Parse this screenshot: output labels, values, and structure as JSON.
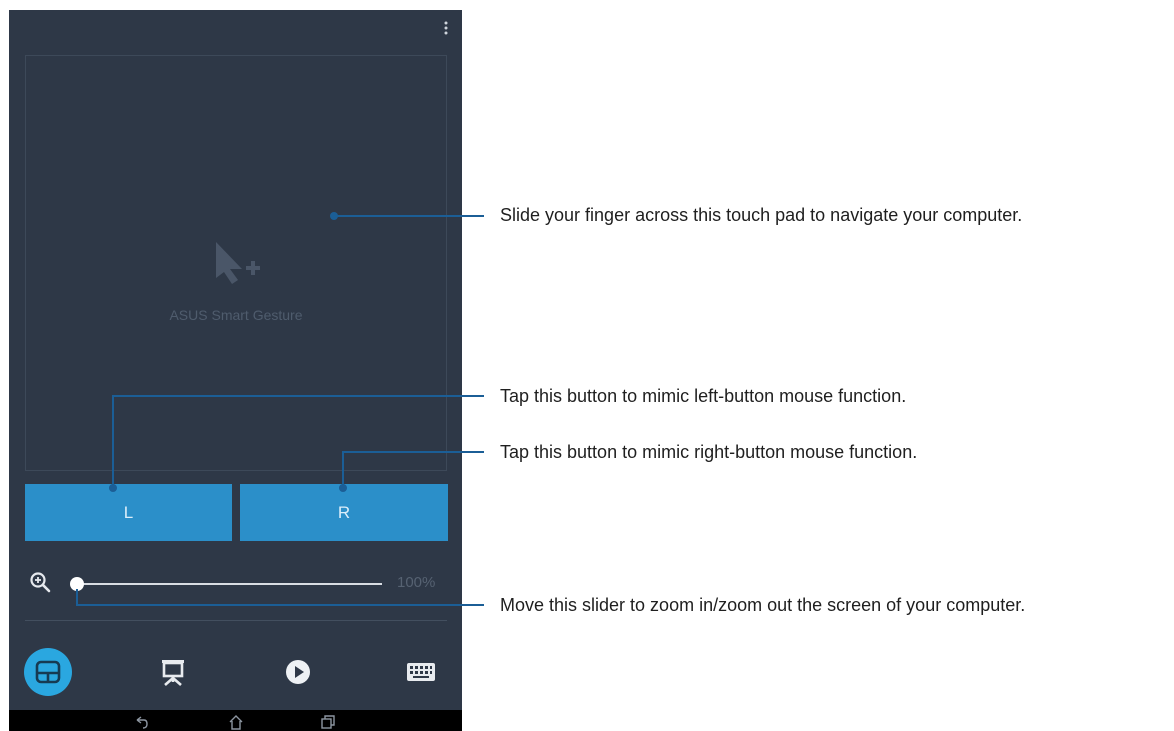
{
  "app": {
    "name": "ASUS Smart Gesture",
    "touchpad_label": "ASUS Smart Gesture",
    "left_button_label": "L",
    "right_button_label": "R",
    "zoom": {
      "value_text": "100%",
      "level": 0.0
    },
    "bottom_nav": [
      {
        "icon": "touchpad-icon",
        "active": true
      },
      {
        "icon": "presentation-icon",
        "active": false
      },
      {
        "icon": "play-icon",
        "active": false
      },
      {
        "icon": "keyboard-icon",
        "active": false
      }
    ],
    "system_nav": [
      "back-icon",
      "home-icon",
      "recents-icon"
    ]
  },
  "callouts": {
    "touchpad": "Slide your finger across this touch pad to navigate your computer.",
    "left_button": "Tap this button to mimic left-button mouse function.",
    "right_button": "Tap this button to mimic right-button mouse function.",
    "zoom_slider": "Move this slider to zoom in/zoom out the screen of your computer."
  },
  "colors": {
    "background": "#2e3847",
    "button": "#2b8fc9",
    "active_nav": "#2aa7e0",
    "callout_line": "#1b5e96"
  }
}
